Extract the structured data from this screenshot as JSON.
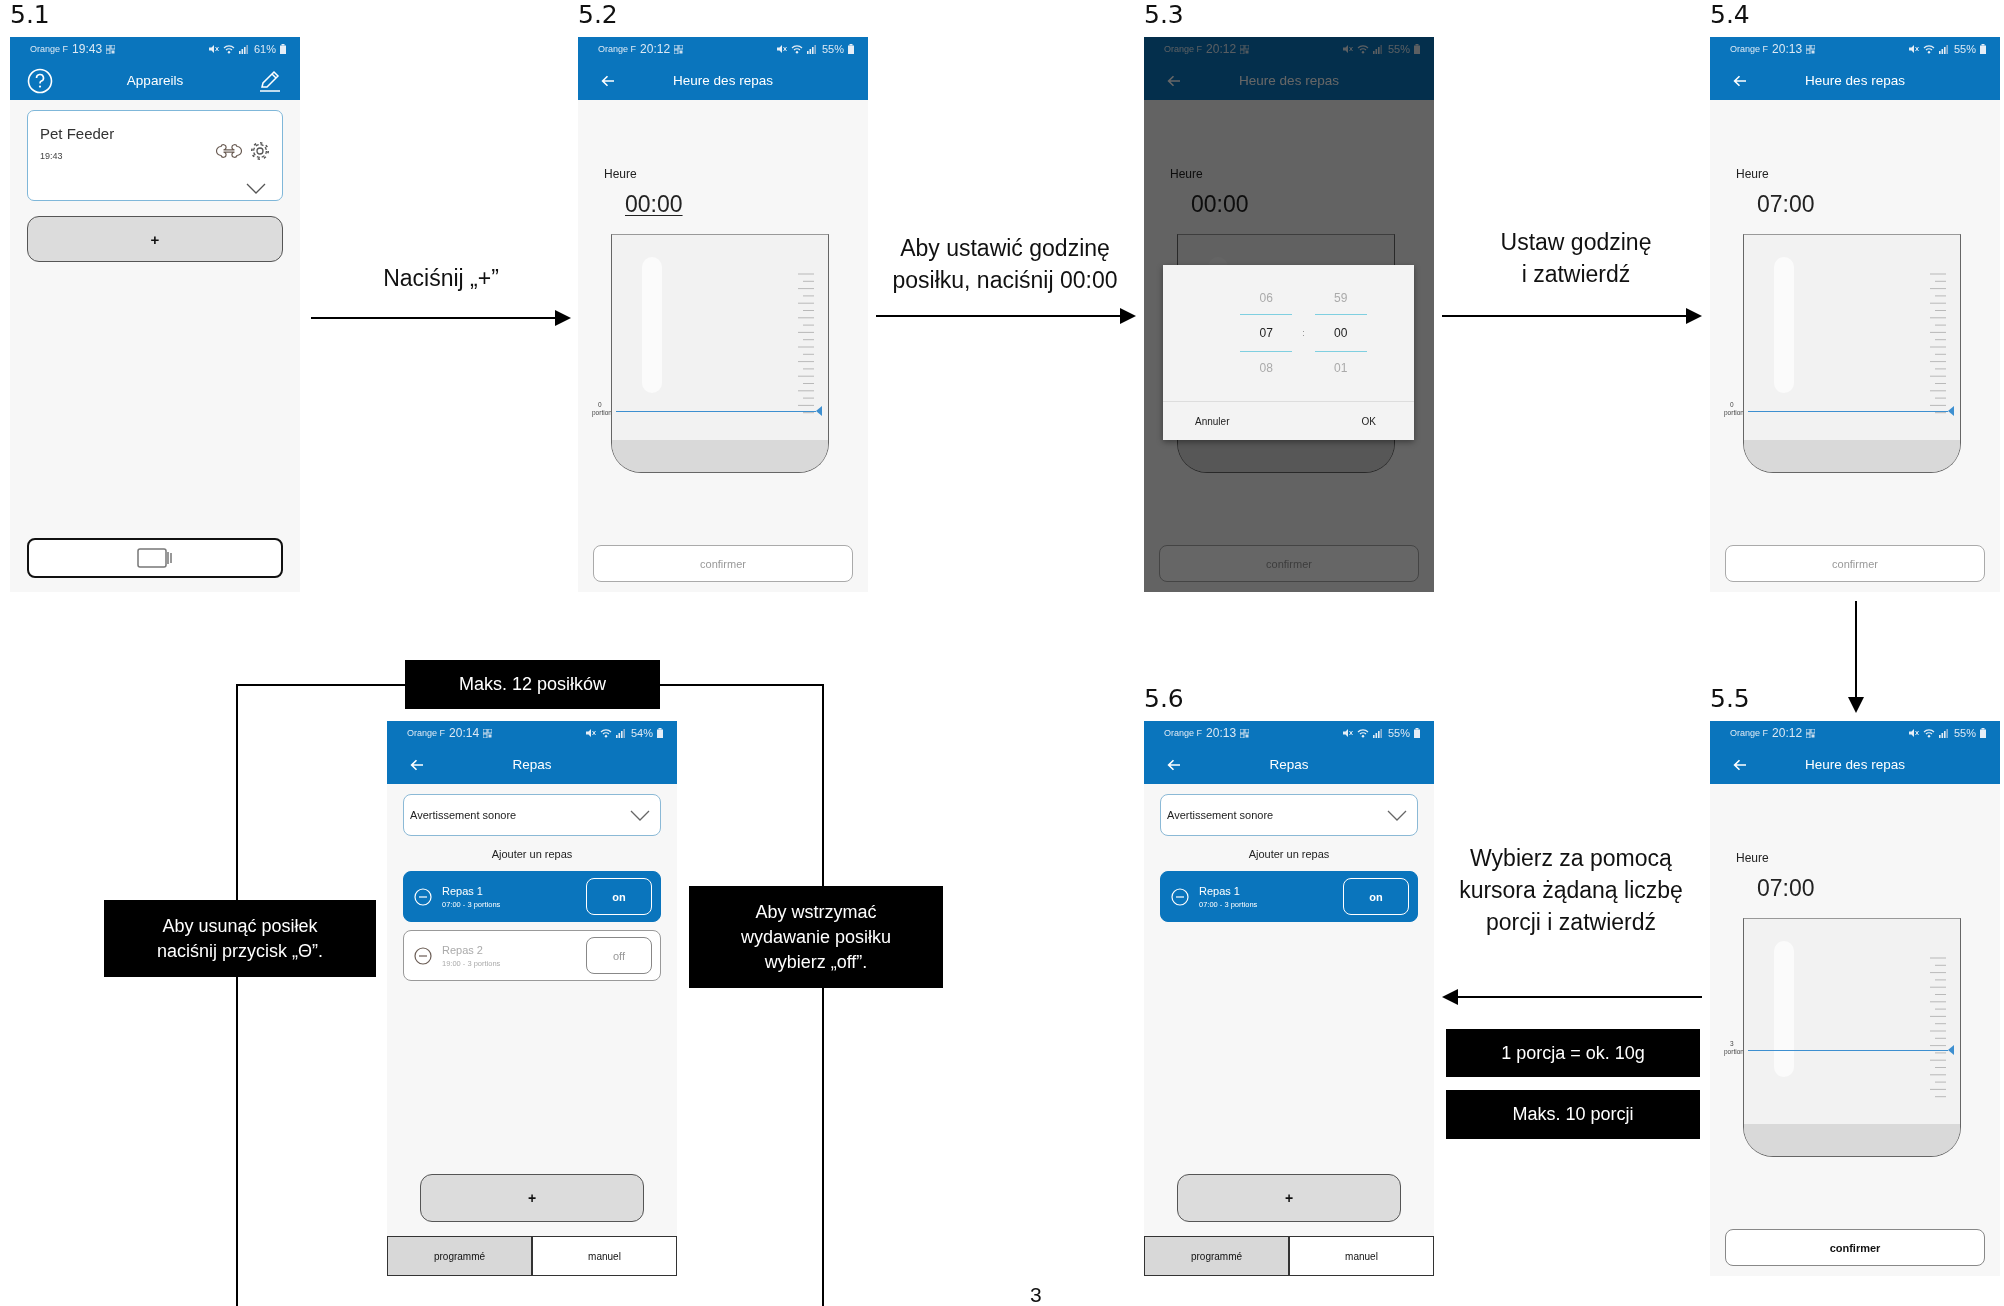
{
  "phones": [
    {
      "label": "5.1",
      "kind": "devices",
      "status": {
        "carrier": "Orange F",
        "time": "19:43",
        "battery": "61%"
      },
      "app_bar": {
        "title": "Appareils",
        "kind": "help",
        "edit": true
      },
      "device": {
        "name": "Pet Feeder",
        "time": "19:43"
      },
      "add_button": "+"
    },
    {
      "label": "5.2",
      "kind": "meal_time",
      "status": {
        "carrier": "Orange F",
        "time": "20:12",
        "battery": "55%"
      },
      "app_bar": {
        "title": "Heure des repas",
        "kind": "back"
      },
      "time_label": "Heure",
      "time_value": "00:00",
      "time_underlined": true,
      "slider": {
        "level": 0,
        "count": "0",
        "unit": "portion"
      },
      "confirm": {
        "label": "confirmer",
        "enabled": false
      }
    },
    {
      "label": "5.3",
      "kind": "meal_time",
      "status": {
        "carrier": "Orange F",
        "time": "20:12",
        "battery": "55%"
      },
      "app_bar": {
        "title": "Heure des repas",
        "kind": "back"
      },
      "time_label": "Heure",
      "time_value": "00:00",
      "time_underlined": false,
      "confirm": {
        "label": "confirmer",
        "enabled": false
      },
      "dimmed": true,
      "picker": {
        "hours": [
          {
            "value": "06",
            "selected": false
          },
          {
            "value": "07",
            "selected": true
          },
          {
            "value": "08",
            "selected": false
          }
        ],
        "minutes": [
          {
            "value": "59",
            "selected": false
          },
          {
            "value": "00",
            "selected": true
          },
          {
            "value": "01",
            "selected": false
          }
        ],
        "separator": ":",
        "cancel": "Annuler",
        "ok": "OK"
      }
    },
    {
      "label": "5.4",
      "kind": "meal_time",
      "status": {
        "carrier": "Orange F",
        "time": "20:13",
        "battery": "55%"
      },
      "app_bar": {
        "title": "Heure des repas",
        "kind": "back"
      },
      "time_label": "Heure",
      "time_value": "07:00",
      "time_underlined": false,
      "slider": {
        "level": 0,
        "count": "0",
        "unit": "portion"
      },
      "confirm": {
        "label": "confirmer",
        "enabled": false
      }
    },
    {
      "kind": "meal_list",
      "status": {
        "carrier": "Orange F",
        "time": "20:14",
        "battery": "54%"
      },
      "app_bar": {
        "title": "Repas",
        "kind": "back"
      },
      "dropdown": "Avertissement sonore",
      "add_label": "Ajouter un repas",
      "meals": [
        {
          "name": "Repas 1",
          "detail": "07:00 - 3 portions",
          "on": true,
          "toggle": "on"
        },
        {
          "name": "Repas 2",
          "detail": "19:00 - 3 portions",
          "on": false,
          "toggle": "off"
        }
      ],
      "add_button": "+",
      "tabs": [
        {
          "label": "programmé",
          "selected": true
        },
        {
          "label": "manuel",
          "selected": false
        }
      ]
    },
    {
      "label": "5.6",
      "kind": "meal_list",
      "status": {
        "carrier": "Orange F",
        "time": "20:13",
        "battery": "55%"
      },
      "app_bar": {
        "title": "Repas",
        "kind": "back"
      },
      "dropdown": "Avertissement sonore",
      "add_label": "Ajouter un repas",
      "meals": [
        {
          "name": "Repas 1",
          "detail": "07:00 - 3 portions",
          "on": true,
          "toggle": "on"
        }
      ],
      "add_button": "+",
      "tabs": [
        {
          "label": "programmé",
          "selected": true
        },
        {
          "label": "manuel",
          "selected": false
        }
      ]
    },
    {
      "label": "5.5",
      "kind": "meal_time",
      "status": {
        "carrier": "Orange F",
        "time": "20:12",
        "battery": "55%"
      },
      "app_bar": {
        "title": "Heure des repas",
        "kind": "back"
      },
      "time_label": "Heure",
      "time_value": "07:00",
      "time_underlined": false,
      "slider": {
        "level": 0.3,
        "count": "3",
        "unit": "portion"
      },
      "confirm": {
        "label": "confirmer",
        "enabled": true
      }
    }
  ],
  "instructions": [
    {
      "text": "Naciśnij „+”"
    },
    {
      "text": "Aby ustawić godzinę\nposiłku, naciśnij 00:00"
    },
    {
      "text": "Ustaw godzinę\ni zatwierdź"
    },
    {
      "text": "Wybierz za pomocą\nkursora żądaną liczbę\nporcji i zatwierdź"
    }
  ],
  "callouts": [
    {
      "text": "Maks. 12 posiłków"
    },
    {
      "text": "Aby usunąć posiłek\nnaciśnij przycisk „Θ”."
    },
    {
      "text": "Aby wstrzymać\nwydawanie posiłku\nwybierz „off”."
    },
    {
      "text": "1 porcja = ok. 10g"
    },
    {
      "text": "Maks. 10 porcji"
    }
  ],
  "page_number": "3"
}
